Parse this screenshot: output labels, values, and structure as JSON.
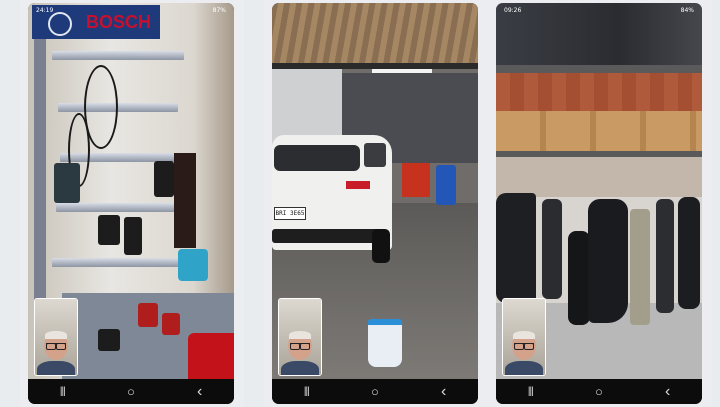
{
  "screens": [
    {
      "time": "24:19",
      "battery": "87%"
    },
    {
      "time": "",
      "battery": ""
    },
    {
      "time": "09:26",
      "battery": "84%"
    }
  ],
  "sign": {
    "brand": "BOSCH"
  },
  "car": {
    "plate": "BRI 3E65"
  },
  "nav": {
    "recent": "|||",
    "home": "○",
    "back": "‹"
  },
  "icons": {
    "recent": "recent-apps-icon",
    "home": "home-icon",
    "back": "back-icon"
  }
}
